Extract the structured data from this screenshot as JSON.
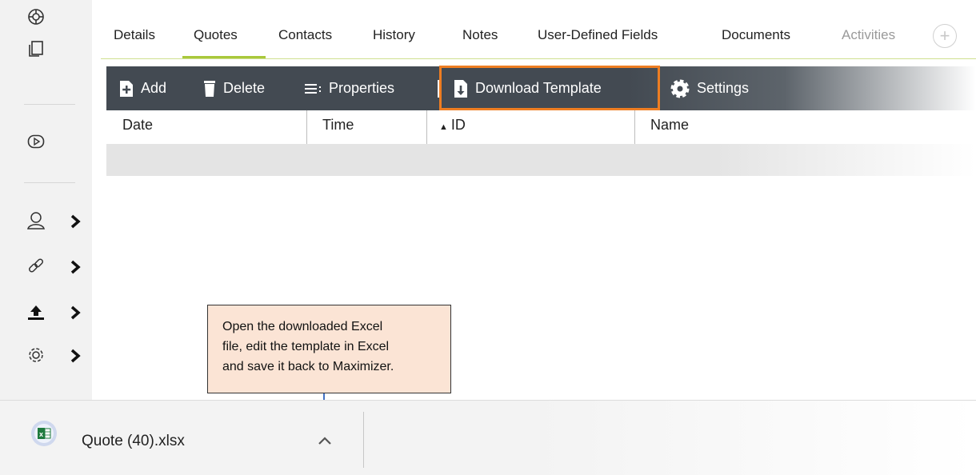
{
  "tabs": {
    "items": [
      {
        "label": "Details"
      },
      {
        "label": "Quotes"
      },
      {
        "label": "Contacts"
      },
      {
        "label": "History"
      },
      {
        "label": "Notes"
      },
      {
        "label": "User-Defined Fields"
      },
      {
        "label": "Documents"
      },
      {
        "label": "Activities"
      }
    ],
    "active": "Quotes",
    "add_icon": "plus-circle-icon"
  },
  "toolbar": {
    "add_label": "Add",
    "delete_label": "Delete",
    "properties_label": "Properties",
    "download_template_label": "Download Template",
    "settings_label": "Settings",
    "highlight_color": "#ee7d22"
  },
  "table": {
    "columns": [
      {
        "label": "Date"
      },
      {
        "label": "Time"
      },
      {
        "label": "ID",
        "sorted": "ascending"
      },
      {
        "label": "Name"
      }
    ],
    "rows": []
  },
  "callout": {
    "lines": [
      "Open the downloaded Excel",
      "file, edit the template in Excel",
      "and save it back to Maximizer."
    ],
    "background": "#fbe4d5",
    "arrow_color": "#4472c4"
  },
  "sidebar": {
    "icons": [
      "lifebuoy-icon",
      "documents-icon",
      "video-play-icon",
      "user-icon",
      "link-icon",
      "upload-icon",
      "gear-icon"
    ]
  },
  "download_bar": {
    "file_name": "Quote (40).xlsx",
    "file_icon": "excel-file-icon"
  },
  "colors": {
    "accent_green": "#a9c83b",
    "toolbar_bg": "#434a52"
  }
}
